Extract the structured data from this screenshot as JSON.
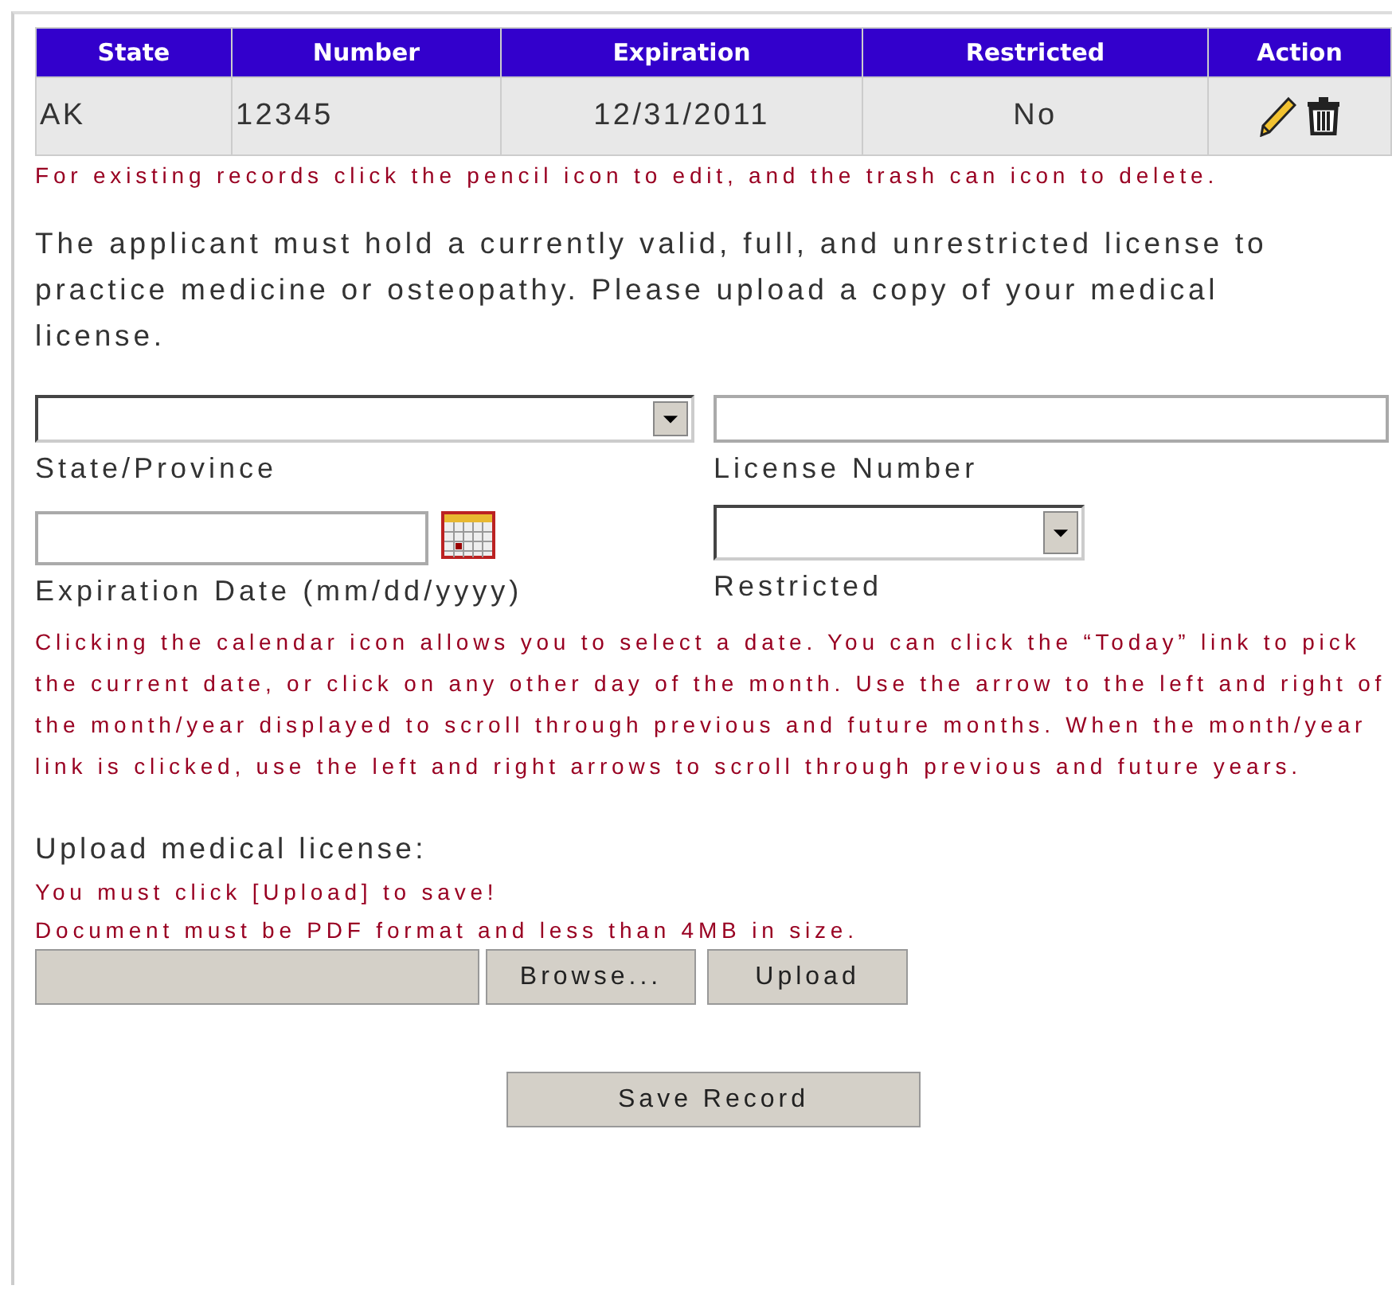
{
  "table": {
    "columns": [
      "State",
      "Number",
      "Expiration",
      "Restricted",
      "Action"
    ],
    "rows": [
      {
        "state": "AK",
        "number": "12345",
        "expiration": "12/31/2011",
        "restricted": "No"
      }
    ]
  },
  "table_note": "For existing records click the pencil icon to edit, and the trash can icon to delete.",
  "intro": "The applicant must hold a currently valid, full, and unrestricted license to practice medicine or osteopathy. Please upload a copy of your medical license.",
  "fields": {
    "state_label": "State/Province",
    "license_label": "License Number",
    "expiration_label": "Expiration Date (mm/dd/yyyy)",
    "restricted_label": "Restricted"
  },
  "calendar_note": "Clicking the calendar icon allows you to select a date. You can click the “Today” link to pick the current date, or click on any other day of the month. Use the arrow to the left and right of the month/year displayed to scroll through previous and future months. When the month/year link is clicked, use the left and right arrows to scroll through previous and future years.",
  "upload": {
    "label": "Upload medical license:",
    "notes": [
      "You must click [Upload] to save!",
      "Document must be PDF format and less than 4MB in size."
    ],
    "browse": "Browse...",
    "button": "Upload"
  },
  "save": "Save Record"
}
